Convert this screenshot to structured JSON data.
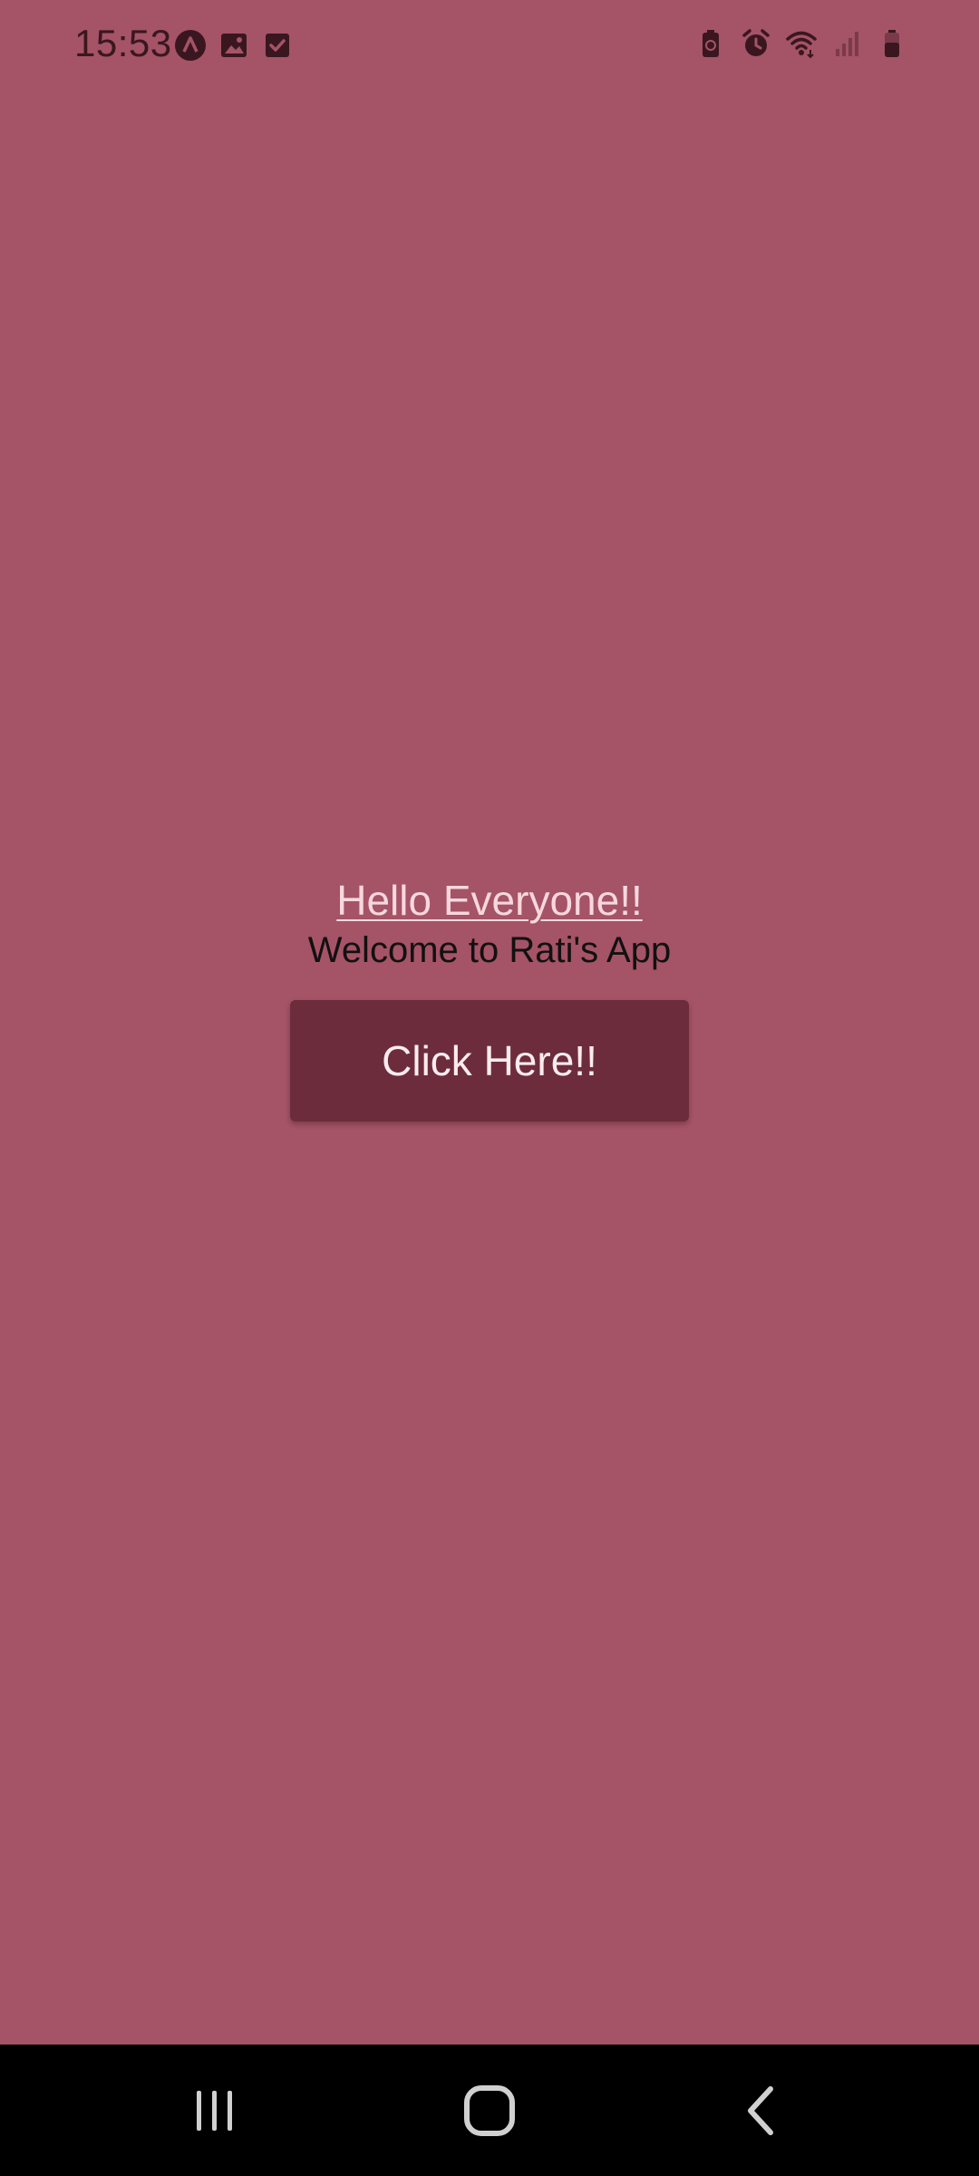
{
  "status_bar": {
    "time": "15:53",
    "left_icons": [
      "notification-app-icon",
      "gallery-icon",
      "checkbox-task-icon"
    ],
    "right_icons": [
      "battery-saver-icon",
      "alarm-icon",
      "wifi-icon",
      "signal-icon",
      "battery-icon"
    ]
  },
  "main": {
    "greeting": "Hello Everyone!!",
    "welcome": "Welcome to Rati's App",
    "button_label": "Click Here!!"
  },
  "nav_bar": {
    "buttons": [
      "recent-apps-icon",
      "home-icon",
      "back-icon"
    ]
  },
  "colors": {
    "background": "#a55366",
    "button": "#6d2c3c",
    "greeting_text": "#f7d7de",
    "nav_bar": "#000000"
  }
}
